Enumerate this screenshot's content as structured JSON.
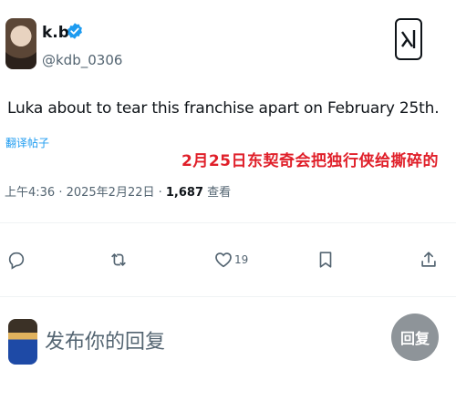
{
  "author": {
    "display_name": "k.b.",
    "handle": "@kdb_0306"
  },
  "tweet": {
    "text": "Luka about to tear this franchise apart on February 25th.",
    "translate_label": "翻译帖子",
    "overlay_caption": "2月25日东契奇会把独行侠给撕碎的",
    "time": "上午4:36 · 2025年2月22日 · ",
    "views_count": "1,687",
    "views_label": " 查看"
  },
  "actions": {
    "reply_icon": "reply-icon",
    "retweet_icon": "retweet-icon",
    "like_icon": "heart-icon",
    "like_count": "19",
    "bookmark_icon": "bookmark-icon",
    "share_icon": "share-icon"
  },
  "composer": {
    "placeholder": "发布你的回复",
    "reply_button": "回复"
  },
  "colors": {
    "accent": "#1d9bf0",
    "annotation": "#e0202a",
    "secondary_text": "#536471",
    "reply_button_bg": "#8e9499"
  }
}
